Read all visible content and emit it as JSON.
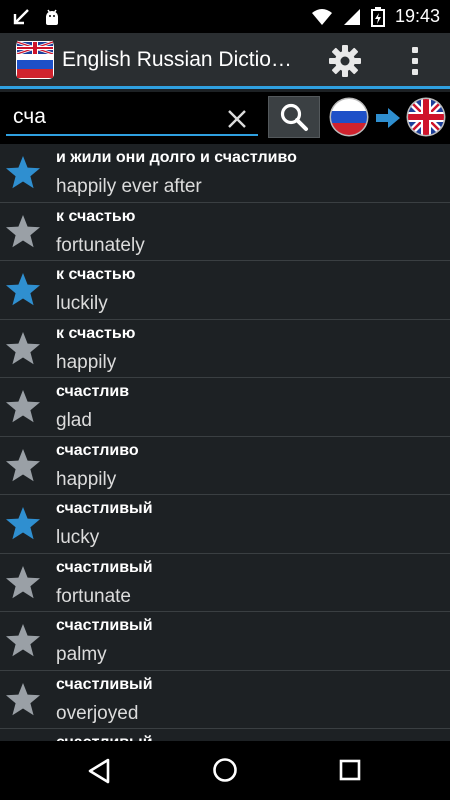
{
  "status_bar": {
    "time": "19:43",
    "icons": [
      "download-done-icon",
      "android-debug-icon",
      "wifi-icon",
      "signal-icon",
      "battery-charging-icon"
    ]
  },
  "app_bar": {
    "title": "English Russian Dictio…",
    "settings_icon": "gear-icon",
    "overflow_icon": "more-vert-icon"
  },
  "search": {
    "value": "сча",
    "placeholder": "",
    "clear_icon": "close-icon",
    "search_icon": "search-icon",
    "from_flag": "russia-flag-icon",
    "to_flag": "uk-flag-icon",
    "direction_icon": "arrow-right-icon"
  },
  "colors": {
    "accent": "#2fa0e0",
    "star_active": "#2f8fd0",
    "star_inactive": "#9aa0a6",
    "background": "#1d2124"
  },
  "results": [
    {
      "word": "и жили они долго и счастливо",
      "translation": "happily ever after",
      "favorite": true
    },
    {
      "word": "к счастью",
      "translation": "fortunately",
      "favorite": false
    },
    {
      "word": "к счастью",
      "translation": "luckily",
      "favorite": true
    },
    {
      "word": "к счастью",
      "translation": "happily",
      "favorite": false
    },
    {
      "word": "счастлив",
      "translation": "glad",
      "favorite": false
    },
    {
      "word": "счастливо",
      "translation": "happily",
      "favorite": false
    },
    {
      "word": "счастливый",
      "translation": "lucky",
      "favorite": true
    },
    {
      "word": "счастливый",
      "translation": "fortunate",
      "favorite": false
    },
    {
      "word": "счастливый",
      "translation": "palmy",
      "favorite": false
    },
    {
      "word": "счастливый",
      "translation": "overjoyed",
      "favorite": false
    },
    {
      "word": "счастливый",
      "translation": "",
      "favorite": false
    }
  ],
  "nav_bar": {
    "back_icon": "back-triangle-icon",
    "home_icon": "home-circle-icon",
    "recents_icon": "recents-square-icon"
  }
}
